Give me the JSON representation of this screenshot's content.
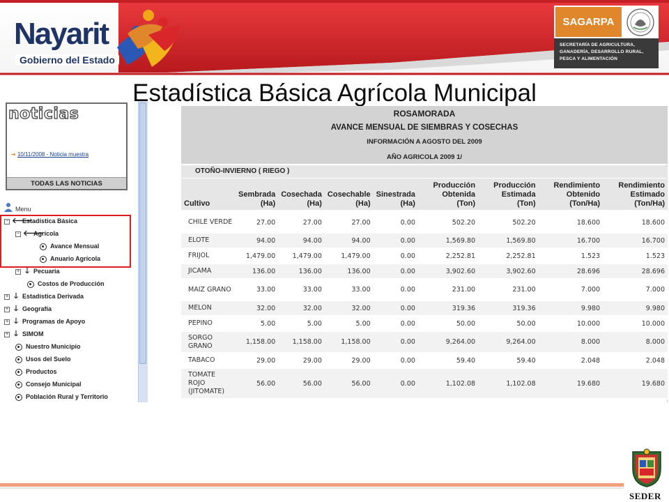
{
  "header": {
    "logo_word": "Nayarit",
    "logo_subtitle": "Gobierno del Estado",
    "sagarpa_name": "SAGARPA",
    "sagarpa_lines": [
      "SECRETARÍA DE AGRICULTURA,",
      "GANADERÍA, DESARROLLO RURAL,",
      "PESCA Y ALIMENTACIÓN"
    ]
  },
  "title": "Estadística Básica Agrícola Municipal",
  "sidebar": {
    "news_heading": "noticias",
    "news_item": "10/11/2008 - Noticia muestra",
    "news_footer": "TODAS LAS NOTICIAS",
    "menu_label": "Menu",
    "items": [
      {
        "label": "Estadística Básica"
      },
      {
        "label": "Agrícola"
      },
      {
        "label": "Avance Mensual"
      },
      {
        "label": "Anuario Agrícola"
      },
      {
        "label": "Pecuaria"
      },
      {
        "label": "Costos de Producción"
      },
      {
        "label": "Estadística Derivada"
      },
      {
        "label": "Geografía"
      },
      {
        "label": "Programas de Apoyo"
      },
      {
        "label": "SIMOM"
      },
      {
        "label": "Nuestro Municipio"
      },
      {
        "label": "Usos del Suelo"
      },
      {
        "label": "Productos"
      },
      {
        "label": "Consejo Municipal"
      },
      {
        "label": "Población Rural y Territorio"
      }
    ]
  },
  "report": {
    "municipality": "ROSAMORADA",
    "heading": "AVANCE MENSUAL DE SIEMBRAS Y COSECHAS",
    "info": "INFORMACIÓN A AGOSTO DEL 2009",
    "year": "AÑO AGRICOLA 2009 1/",
    "season": "OTOÑO-INVIERNO ( RIEGO )",
    "columns": [
      [
        "Cultivo",
        ""
      ],
      [
        "Sembrada",
        "(Ha)"
      ],
      [
        "Cosechada",
        "(Ha)"
      ],
      [
        "Cosechable",
        "(Ha)"
      ],
      [
        "Sinestrada",
        "(Ha)"
      ],
      [
        "Producción Obtenida",
        "(Ton)"
      ],
      [
        "Producción Estimada",
        "(Ton)"
      ],
      [
        "Rendimiento Obtenido",
        "(Ton/Ha)"
      ],
      [
        "Rendimiento Estimado",
        "(Ton/Ha)"
      ]
    ],
    "rows": [
      [
        "CHILE VERDE",
        "27.00",
        "27.00",
        "27.00",
        "0.00",
        "502.20",
        "502.20",
        "18.600",
        "18.600"
      ],
      [
        "ELOTE",
        "94.00",
        "94.00",
        "94.00",
        "0.00",
        "1,569.80",
        "1,569.80",
        "16.700",
        "16.700"
      ],
      [
        "FRIJOL",
        "1,479.00",
        "1,479.00",
        "1,479.00",
        "0.00",
        "2,252.81",
        "2,252.81",
        "1.523",
        "1.523"
      ],
      [
        "JICAMA",
        "136.00",
        "136.00",
        "136.00",
        "0.00",
        "3,902.60",
        "3,902.60",
        "28.696",
        "28.696"
      ],
      [
        "MAIZ GRANO",
        "33.00",
        "33.00",
        "33.00",
        "0.00",
        "231.00",
        "231.00",
        "7.000",
        "7.000"
      ],
      [
        "MELON",
        "32.00",
        "32.00",
        "32.00",
        "0.00",
        "319.36",
        "319.36",
        "9.980",
        "9.980"
      ],
      [
        "PEPINO",
        "5.00",
        "5.00",
        "5.00",
        "0.00",
        "50.00",
        "50.00",
        "10.000",
        "10.000"
      ],
      [
        "SORGO GRANO",
        "1,158.00",
        "1,158.00",
        "1,158.00",
        "0.00",
        "9,264.00",
        "9,264.00",
        "8.000",
        "8.000"
      ],
      [
        "TABACO",
        "29.00",
        "29.00",
        "29.00",
        "0.00",
        "59.40",
        "59.40",
        "2.048",
        "2.048"
      ],
      [
        "TOMATE ROJO (JITOMATE)",
        "56.00",
        "56.00",
        "56.00",
        "0.00",
        "1,102.08",
        "1,102.08",
        "19.680",
        "19.680"
      ]
    ]
  },
  "footer": {
    "label": "SEDER"
  },
  "colors": {
    "accent_red": "#d8262a",
    "table_header": "#d3d3d3",
    "highlight": "#e01b1b",
    "sagarpa_orange": "#e0872c"
  }
}
